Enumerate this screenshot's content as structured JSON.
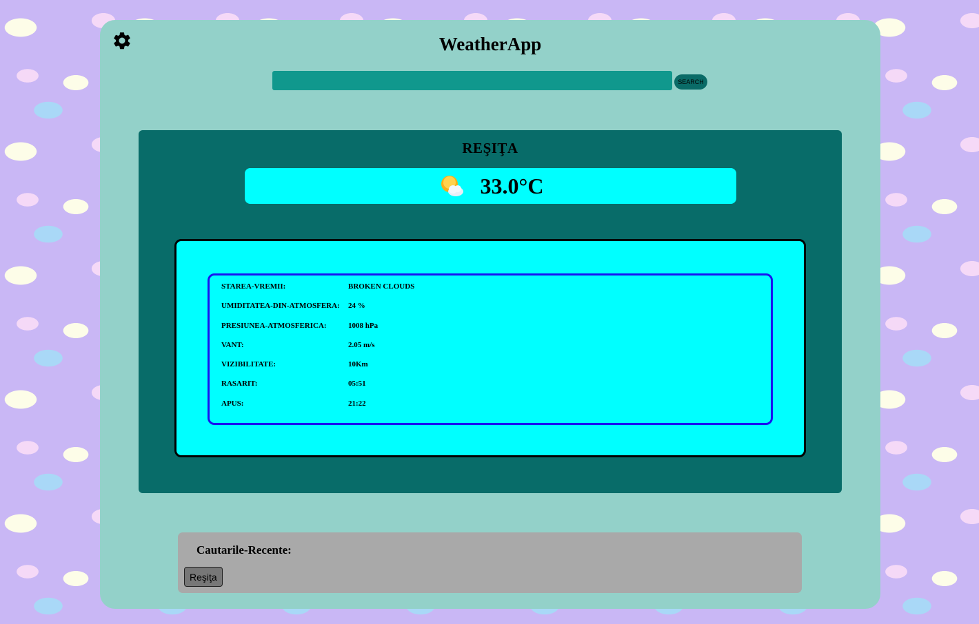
{
  "app": {
    "title": "WeatherApp",
    "settings_icon": "gear-icon"
  },
  "search": {
    "value": "",
    "placeholder": "",
    "button_label": "SEARCH"
  },
  "current": {
    "city": "REŞIŢA",
    "temperature": "33.0°C",
    "weather_icon": "sun-behind-cloud-icon"
  },
  "details": [
    {
      "label": "STAREA-VREMII:",
      "value": "BROKEN CLOUDS"
    },
    {
      "label": "UMIDITATEA-DIN-ATMOSFERA:",
      "value": "24 %"
    },
    {
      "label": "PRESIUNEA-ATMOSFERICA:",
      "value": "1008 hPa"
    },
    {
      "label": "VANT:",
      "value": "2.05 m/s"
    },
    {
      "label": "VIZIBILITATE:",
      "value": "10Km"
    },
    {
      "label": "RASARIT:",
      "value": "05:51"
    },
    {
      "label": "APUS:",
      "value": "21:22"
    }
  ],
  "recent": {
    "title": "Cautarile-Recente:",
    "items": [
      "Reşiţa"
    ]
  },
  "colors": {
    "app_bg": "#93d1c9",
    "panel_bg": "#086c69",
    "highlight": "#00ffff",
    "inner_border": "#1a12f0",
    "search_bg": "#10988d",
    "recent_bg": "#a9a9a9"
  }
}
